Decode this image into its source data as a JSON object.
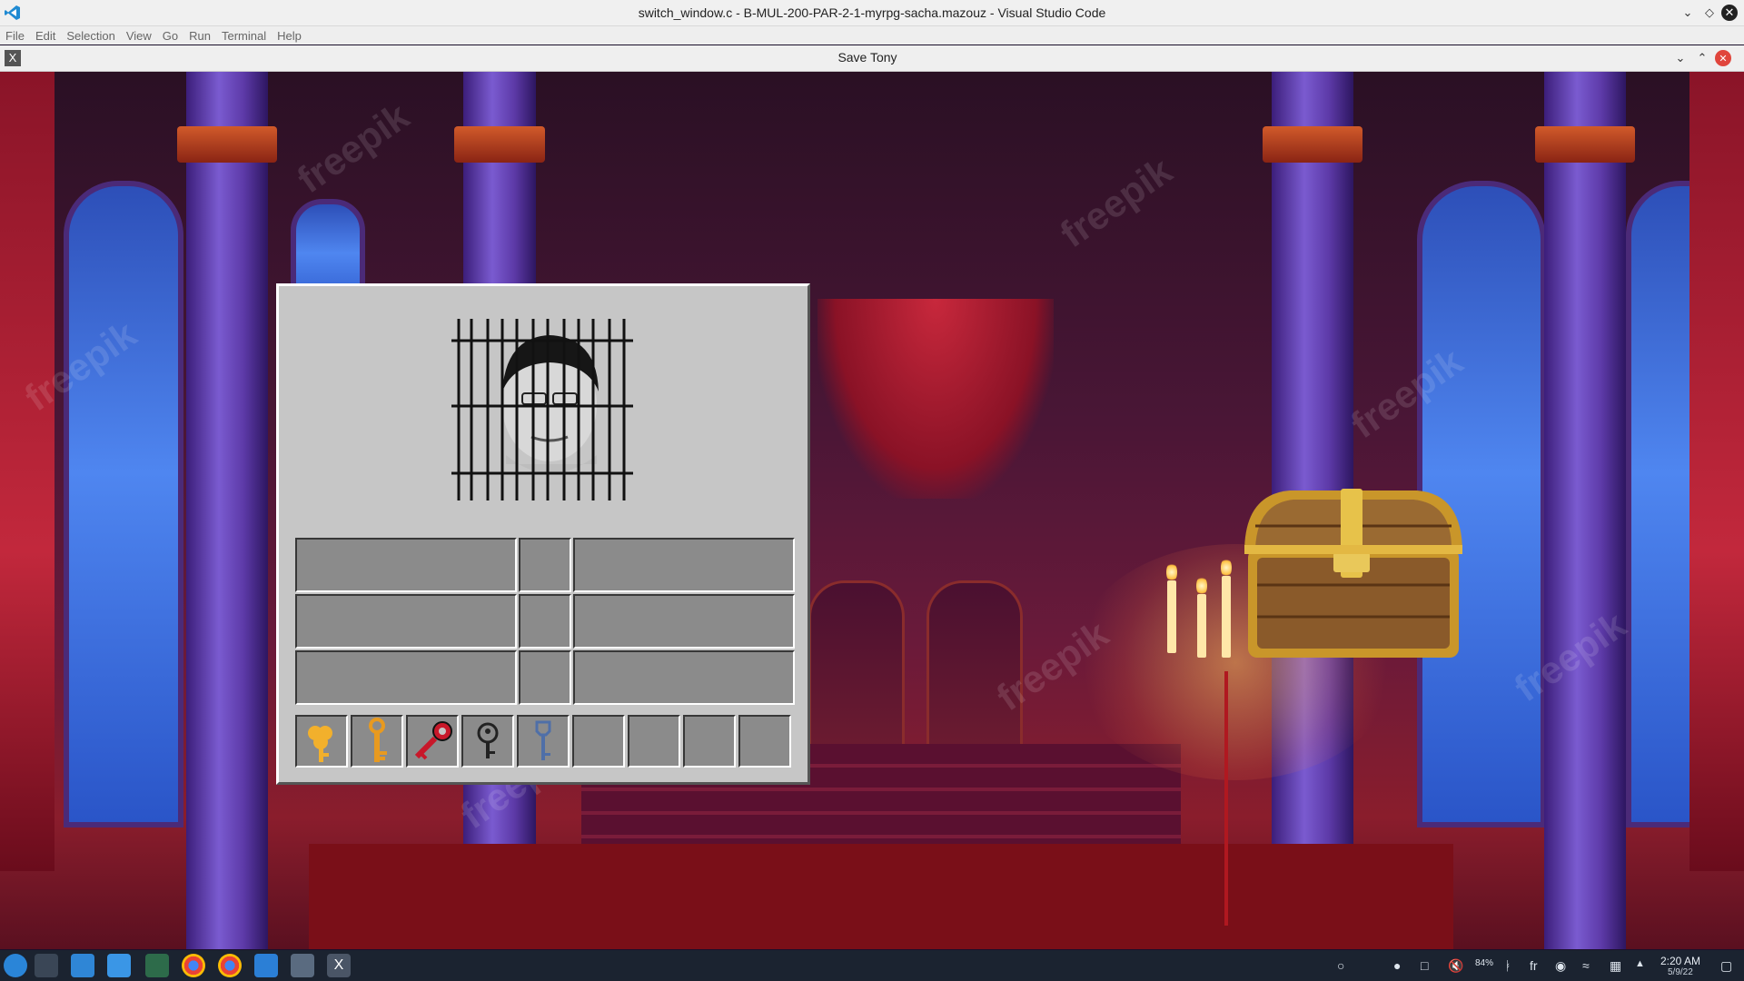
{
  "vscode": {
    "title": "switch_window.c - B-MUL-200-PAR-2-1-myrpg-sacha.mazouz - Visual Studio Code",
    "menu": [
      "File",
      "Edit",
      "Selection",
      "View",
      "Go",
      "Run",
      "Terminal",
      "Help"
    ]
  },
  "game_window": {
    "title": "Save Tony"
  },
  "scene": {
    "watermark": "freepik"
  },
  "inventory": {
    "portrait_icon": "jailed-portrait-icon",
    "grid_rows": 3,
    "hotbar_items": [
      {
        "icon": "gold-key-icon",
        "color": "#f2b02c"
      },
      {
        "icon": "ornate-gold-key-icon",
        "color": "#e89a20"
      },
      {
        "icon": "red-key-icon",
        "color": "#c8182a"
      },
      {
        "icon": "black-keyhole-key-icon",
        "color": "#222222"
      },
      {
        "icon": "blue-key-icon",
        "color": "#4f6fa8"
      },
      {
        "icon": "empty-slot",
        "color": ""
      },
      {
        "icon": "empty-slot",
        "color": ""
      },
      {
        "icon": "empty-slot",
        "color": ""
      },
      {
        "icon": "empty-slot",
        "color": ""
      }
    ]
  },
  "chest": {
    "icon": "treasure-chest-icon"
  },
  "taskbar": {
    "time": "2:20 AM",
    "date": "5/9/22",
    "keyboard_layout": "fr",
    "battery_text": "84%"
  }
}
